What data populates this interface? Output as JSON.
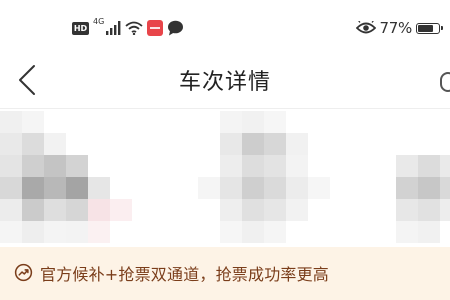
{
  "status_bar": {
    "hd_label": "HD",
    "network_label": "4G",
    "battery_percent": "77%",
    "battery_level": 0.77,
    "icons": [
      "hd-icon",
      "signal-icon",
      "wifi-icon",
      "app-notification-icon",
      "message-icon",
      "eye-comfort-icon",
      "battery-icon"
    ]
  },
  "nav": {
    "title": "车次详情",
    "icons": [
      "back-arrow-icon"
    ]
  },
  "promo": {
    "text": "官方候补+抢票双通道，抢票成功率更高",
    "icon": "trend-up-icon"
  },
  "colors": {
    "banner_bg": "#fdf3e6",
    "banner_text": "#7a3d1a",
    "notification_red": "#e8454a"
  }
}
